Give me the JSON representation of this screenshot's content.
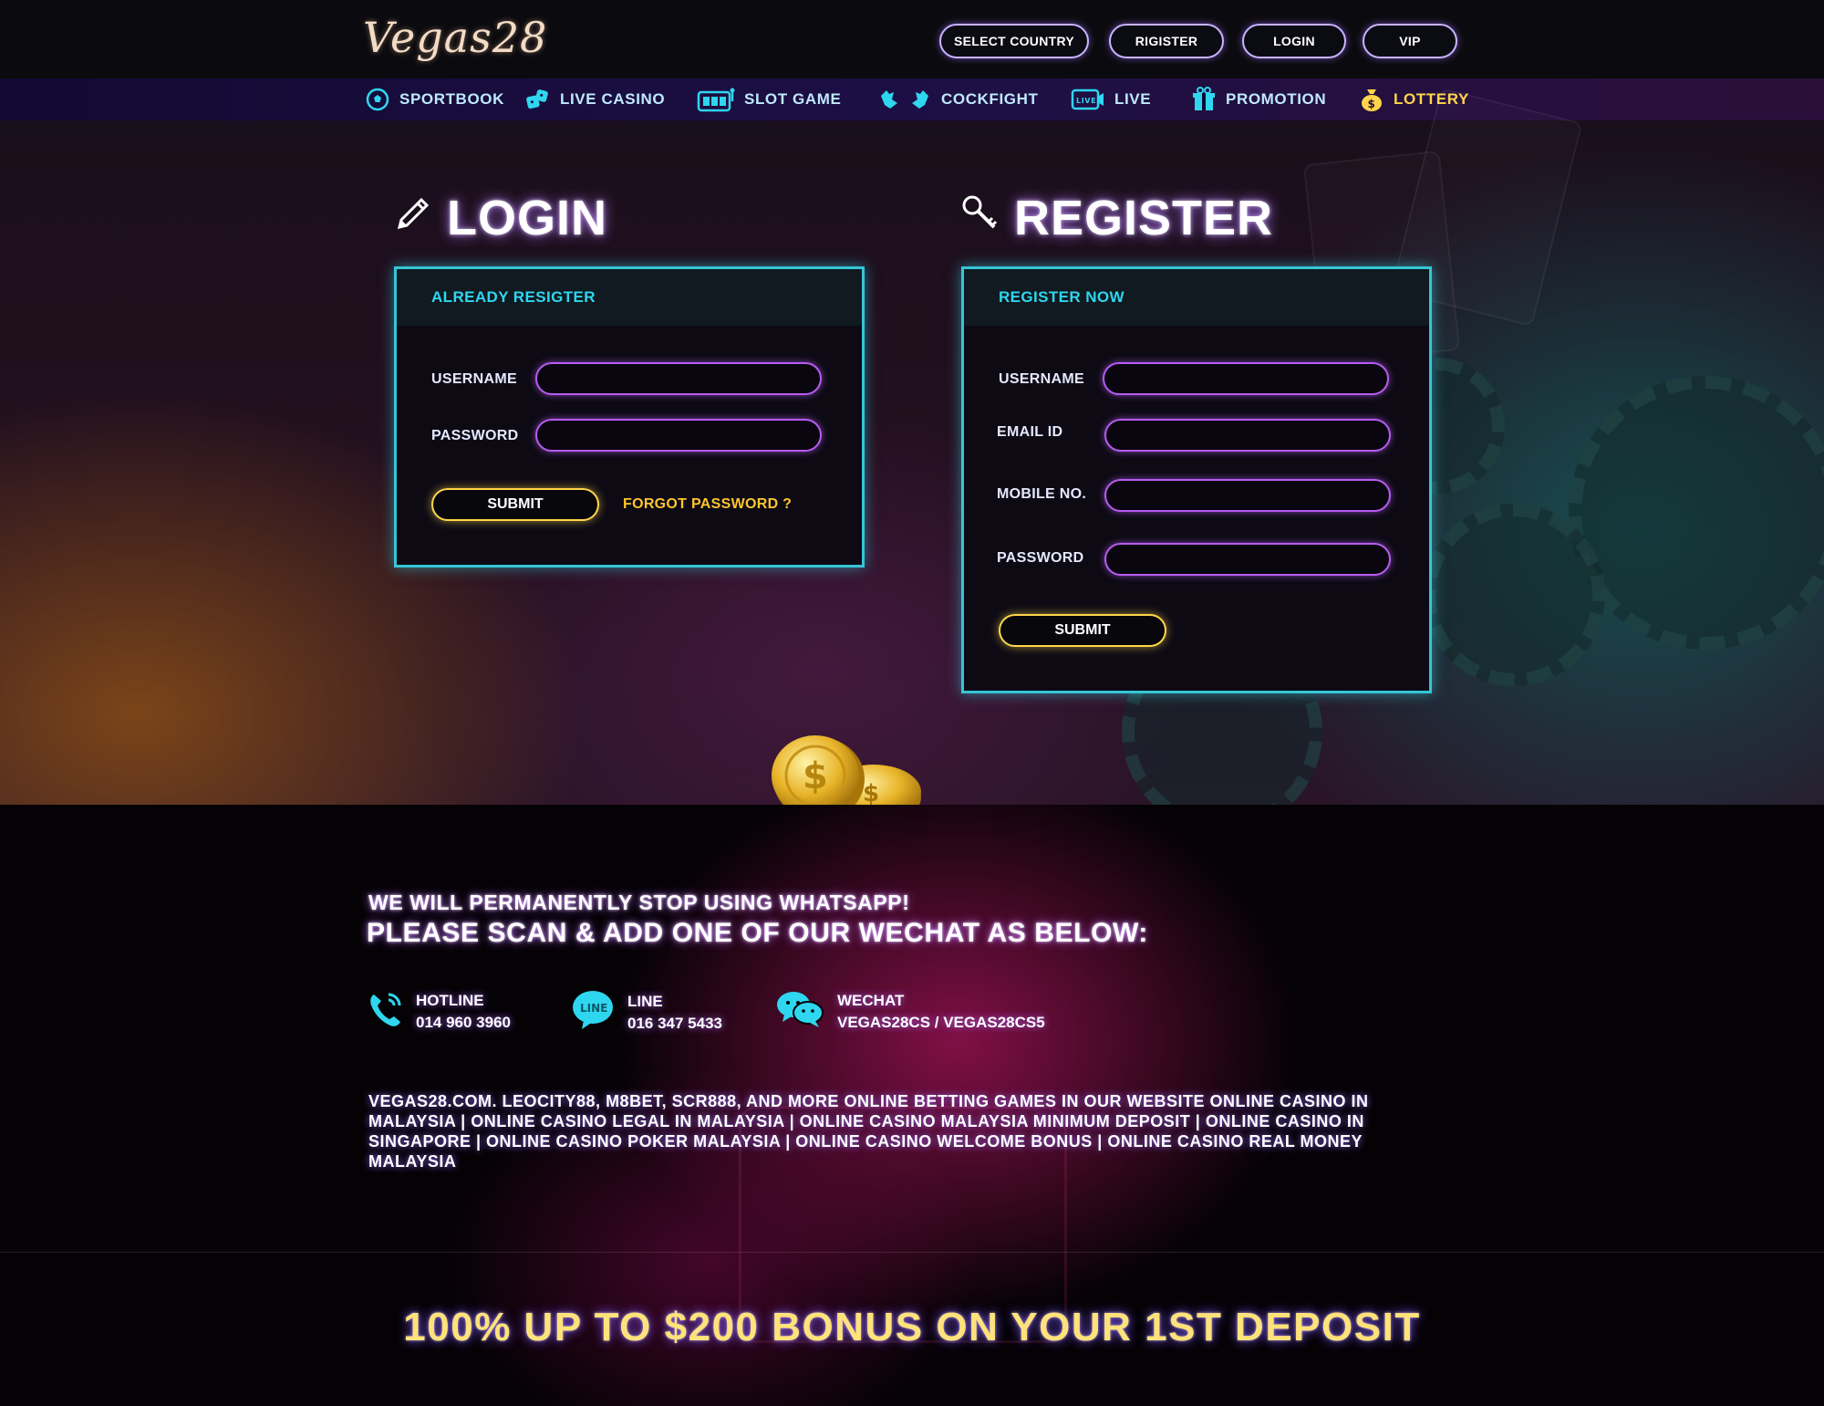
{
  "header": {
    "logo": "Vegas28",
    "buttons": {
      "select_country": "SELECT COUNTRY",
      "register": "RIGISTER",
      "login": "LOGIN",
      "vip": "VIP"
    }
  },
  "nav": {
    "items": [
      {
        "label": "SPORTBOOK",
        "icon": "soccer-ball-icon"
      },
      {
        "label": "LIVE CASINO",
        "icon": "dice-icon"
      },
      {
        "label": "SLOT GAME",
        "icon": "slot-machine-icon"
      },
      {
        "label": "COCKFIGHT",
        "icon": "rooster-icon"
      },
      {
        "label": "LIVE",
        "icon": "live-tv-icon"
      },
      {
        "label": "PROMOTION",
        "icon": "gift-icon"
      },
      {
        "label": "LOTTERY",
        "icon": "money-bag-icon"
      }
    ],
    "active": "LOTTERY"
  },
  "login": {
    "title": "LOGIN",
    "icon": "pencil-icon",
    "panel_heading": "ALREADY RESIGTER",
    "username_label": "USERNAME",
    "password_label": "PASSWORD",
    "username_value": "",
    "password_value": "",
    "submit_label": "SUBMIT",
    "forgot_label": "FORGOT PASSWORD ?"
  },
  "register": {
    "title": "REGISTER",
    "icon": "key-icon",
    "panel_heading": "REGISTER NOW",
    "username_label": "USERNAME",
    "email_label": "EMAIL ID",
    "mobile_label": "MOBILE NO.",
    "password_label": "PASSWORD",
    "username_value": "",
    "email_value": "",
    "mobile_value": "",
    "password_value": "",
    "submit_label": "SUBMIT"
  },
  "footer": {
    "notice_line1": "WE WILL PERMANENTLY STOP USING WHATSAPP!",
    "notice_line2": "PLEASE SCAN & ADD ONE OF OUR WECHAT AS BELOW:",
    "contacts": [
      {
        "label": "HOTLINE",
        "value": "014 960 3960",
        "icon": "phone-icon"
      },
      {
        "label": "LINE",
        "value": "016 347 5433",
        "icon": "line-icon",
        "icon_text": "LINE"
      },
      {
        "label": "WECHAT",
        "value": "VEGAS28CS / VEGAS28CS5",
        "icon": "wechat-icon"
      }
    ],
    "keywords": "VEGAS28.COM. LEOCITY88, M8BET, SCR888, AND MORE ONLINE BETTING GAMES IN OUR WEBSITE ONLINE CASINO IN MALAYSIA | ONLINE CASINO LEGAL IN MALAYSIA | ONLINE CASINO MALAYSIA MINIMUM DEPOSIT | ONLINE CASINO IN SINGAPORE | ONLINE CASINO POKER MALAYSIA | ONLINE CASINO WELCOME BONUS | ONLINE CASINO REAL MONEY MALAYSIA",
    "bonus": "100% UP TO $200 BONUS ON YOUR 1ST DEPOSIT"
  },
  "colors": {
    "accent_cyan": "#35c5d6",
    "accent_purple": "#b65cf0",
    "accent_gold": "#ffd54a",
    "nav_text": "#bfe9ff"
  }
}
